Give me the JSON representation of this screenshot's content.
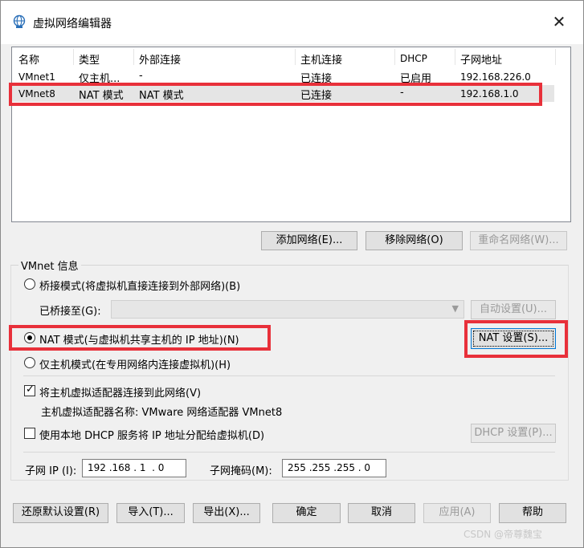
{
  "window": {
    "title": "虚拟网络编辑器",
    "close_label": "✕"
  },
  "table": {
    "columns": [
      "名称",
      "类型",
      "外部连接",
      "主机连接",
      "DHCP",
      "子网地址"
    ],
    "rows": [
      [
        "VMnet1",
        "仅主机...",
        "-",
        "已连接",
        "已启用",
        "192.168.226.0"
      ],
      [
        "VMnet8",
        "NAT 模式",
        "NAT 模式",
        "已连接",
        "-",
        "192.168.1.0"
      ]
    ],
    "selected_row": 1
  },
  "list_buttons": {
    "add": "添加网络(E)...",
    "remove": "移除网络(O)",
    "rename": "重命名网络(W)..."
  },
  "vmnet_info": {
    "group_label": "VMnet 信息",
    "bridge_label": "桥接模式(将虚拟机直接连接到外部网络)(B)",
    "bridged_to_label": "已桥接至(G):",
    "bridged_to_value": "",
    "auto_settings": "自动设置(U)...",
    "nat_label": "NAT 模式(与虚拟机共享主机的 IP 地址)(N)",
    "nat_settings": "NAT 设置(S)...",
    "hostonly_label": "仅主机模式(在专用网络内连接虚拟机)(H)",
    "mode_selected": "nat",
    "connect_adapter_label": "将主机虚拟适配器连接到此网络(V)",
    "connect_adapter_checked": true,
    "adapter_name_label": "主机虚拟适配器名称: VMware 网络适配器 VMnet8",
    "dhcp_label": "使用本地 DHCP 服务将 IP 地址分配给虚拟机(D)",
    "dhcp_checked": false,
    "dhcp_settings": "DHCP 设置(P)...",
    "subnet_ip_label": "子网 IP (I):",
    "subnet_ip_value": "192 .168 . 1  . 0",
    "subnet_mask_label": "子网掩码(M):",
    "subnet_mask_value": "255 .255 .255 . 0"
  },
  "footer_buttons": {
    "restore": "还原默认设置(R)",
    "import": "导入(T)...",
    "export": "导出(X)...",
    "ok": "确定",
    "cancel": "取消",
    "apply": "应用(A)",
    "help": "帮助"
  },
  "watermark": "CSDN @帝尊魏宝",
  "colors": {
    "highlight": "#e8303a",
    "selected_row": "#e5e5e5",
    "focus": "#0078d7"
  }
}
